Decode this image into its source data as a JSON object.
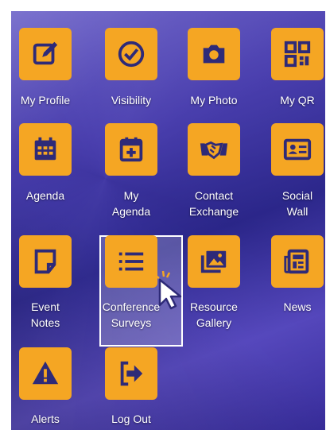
{
  "colors": {
    "tile": "#f5a623",
    "icon": "#2e2a78",
    "label": "#ffffff"
  },
  "items": [
    {
      "label": "My Profile",
      "icon": "edit-icon"
    },
    {
      "label": "Visibility",
      "icon": "check-circle-icon"
    },
    {
      "label": "My Photo",
      "icon": "camera-icon"
    },
    {
      "label": "My QR",
      "icon": "qr-code-icon"
    },
    {
      "label": "Agenda",
      "icon": "calendar-icon"
    },
    {
      "label": "My\nAgenda",
      "icon": "calendar-plus-icon"
    },
    {
      "label": "Contact\nExchange",
      "icon": "handshake-icon"
    },
    {
      "label": "Social\nWall",
      "icon": "id-card-icon"
    },
    {
      "label": "Event\nNotes",
      "icon": "sticky-note-icon"
    },
    {
      "label": "Conference\nSurveys",
      "icon": "list-icon"
    },
    {
      "label": "Resource\nGallery",
      "icon": "images-icon"
    },
    {
      "label": "News",
      "icon": "newspaper-icon"
    },
    {
      "label": "Alerts",
      "icon": "warning-icon"
    },
    {
      "label": "Log Out",
      "icon": "sign-out-icon"
    }
  ]
}
